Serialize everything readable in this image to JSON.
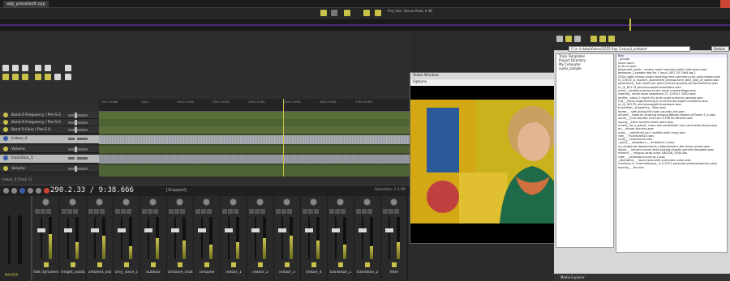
{
  "window": {
    "tab_title": "adp_presetsoft.cpp"
  },
  "toolbar": {
    "info": "Proj rate: Stereo Peak: 0 dB"
  },
  "tracks": [
    {
      "label": "Band 6 Frequency / Pre-S 0",
      "type": "env"
    },
    {
      "label": "Band 6 Frequency / Pre-S 0",
      "type": "env"
    },
    {
      "label": "Band 0 Gain / Pre-S 0",
      "type": "env"
    },
    {
      "label": "indoor_4",
      "type": "track"
    },
    {
      "label": "Volume",
      "type": "env"
    },
    {
      "label": "transition_1",
      "type": "track"
    },
    {
      "label": "Volume",
      "type": "env"
    }
  ],
  "ruler": [
    "198.1.90MB",
    "248.1",
    "258.1.00ЮL",
    "258.1.00ЮL",
    "258.1.00ЮL",
    "268.1.00ЮL",
    "268.1.00ЮL",
    "278.1.00ЮL"
  ],
  "track_label": "indoor_4 [Track 1]",
  "transport": {
    "time": "290.2.33 / 9:38.666",
    "status": "[Stopped]",
    "selection": "Selection: 1.1.00"
  },
  "master": {
    "label": "MASTER"
  },
  "mixer": [
    "folk (tynoners",
    "frsight_outdo",
    "ambient_out",
    "only_voice_c",
    "outdoor",
    "cenzone_chat",
    "cenzone",
    "indoor_1",
    "indoor_2",
    "indoor_3",
    "indoor_4",
    "transition_1",
    "transition_2",
    "filter"
  ],
  "video": {
    "title": "Video Window",
    "menu": "Options"
  },
  "explorer": {
    "path": "G:\\n 4 data/Videos\\2022-Sep 3:sound_ambient",
    "details": "Details",
    "filter": "filte",
    "tree": [
      "Track Templates",
      "Project Directory",
      "My Computer",
      "audio_sample"
    ],
    "files": [
      "_private",
      "small room",
      "b_lib-ch.wav",
      "bassment audio - empty room haunted public bathroom.wav",
      "bedroom_2 people dog for 1 hour 2407.2S 2944.bq.2",
      "2003-night-school-single-bustling-time-summery-city-road-reaper.wav",
      "rk_22022_b_modern_apartment_atmosphere_with_wall_of_water.wav",
      "apartment_ hall asard sec-wind-chimes-quartet-at-frontstretche.wav",
      "nt_rk_82173_electrocepaplintcaaldone.wav",
      "ment_ combat-moving-music-room-ccamouflage.wav",
      "cleaned_ small room basement 07-120911 0452.wav",
      "amfire_ alone 2 night city brits quiet summer genesis.wav",
      "ruit_ _many-dogs-barking-in-a-small-city-slight-rainstorm.wav",
      "nt_rk_00279_electrocepaplintcaaldone.wav",
      "tructhfeel_ shapelicty_ 56ac.wav",
      "home_ _ soft-dialog Nd night_sounds_mb.wav",
      "ultures_ _thebum_busking amping-Woody-legend of flame 2_e.wav",
      "vanel_ _curb-donate 1042-pm 2736 lib-fanlock.wav",
      "sound_ _kitco-routine-small-room.wav",
      "ument_rol_a_patrol_ room-low-ventilation-hum-and-relax-shoes.wav",
      "on_ _dinner-burning.wav",
      "xzire_ _ priorfine4-ne-2 exhibit-walk-rings.wav",
      "ram_ _ monitored23.wav",
      "ronty__ roomscene.wav",
      "_quiet_ _ neighbour__ ambience-1.wav",
      "oo_ambiente-departments_cabinelement_dinnercel_street.wav",
      "stood_ _ autumn-home-keys-talking-chosen-pervest-tarpabie.wav",
      "ntment_ _ shogun-wrap-wrap 180326_2944.lba",
      "reter_ _cardboard-turning-1.wav",
      "_ebanothe_ _ room-tone-with-computer-noise.wav",
      "monitors-in-cinemoleaque_ 4-5-2011-personal-pretavoltpantics.wav",
      "toxicity_ _ fire-fox"
    ]
  }
}
